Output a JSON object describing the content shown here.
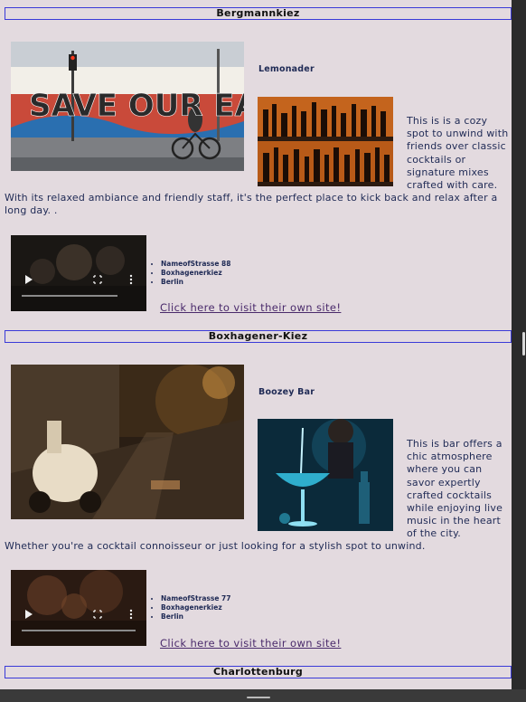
{
  "sections": [
    {
      "district": "Bergmannkiez",
      "bar_name": "Lemonader",
      "description_wrapped": "This is is a cozy spot to unwind with friends over classic cocktails or signature mixes crafted with care.",
      "description_continued": "With its relaxed ambiance and friendly staff, it's the perfect place to kick back and relax after a long day. .",
      "address": [
        "NameofStrasse 88",
        "Boxhagenerkiez",
        "Berlin"
      ],
      "link_text": "Click here to visit their own site!",
      "hero_image_text": "SAVE OUR EART"
    },
    {
      "district": "Boxhagener-Kiez",
      "bar_name": "Boozey Bar",
      "description_wrapped": "This is bar offers a chic atmosphere where you can savor expertly crafted cocktails while enjoying live music in the heart of the city.",
      "description_continued": "Whether you're a cocktail connoisseur or just looking for a stylish spot to unwind.",
      "address": [
        "NameofStrasse 77",
        "Boxhagenerkiez",
        "Berlin"
      ],
      "link_text": "Click here to visit their own site!"
    },
    {
      "district": "Charlottenburg"
    }
  ],
  "icons": {
    "play": "play-icon",
    "fullscreen": "fullscreen-icon",
    "more": "more-options-icon"
  },
  "colors": {
    "page_background": "#e3dadf",
    "header_border": "#3a3ad8",
    "text": "#1f2a55",
    "link": "#4a2a6b"
  }
}
